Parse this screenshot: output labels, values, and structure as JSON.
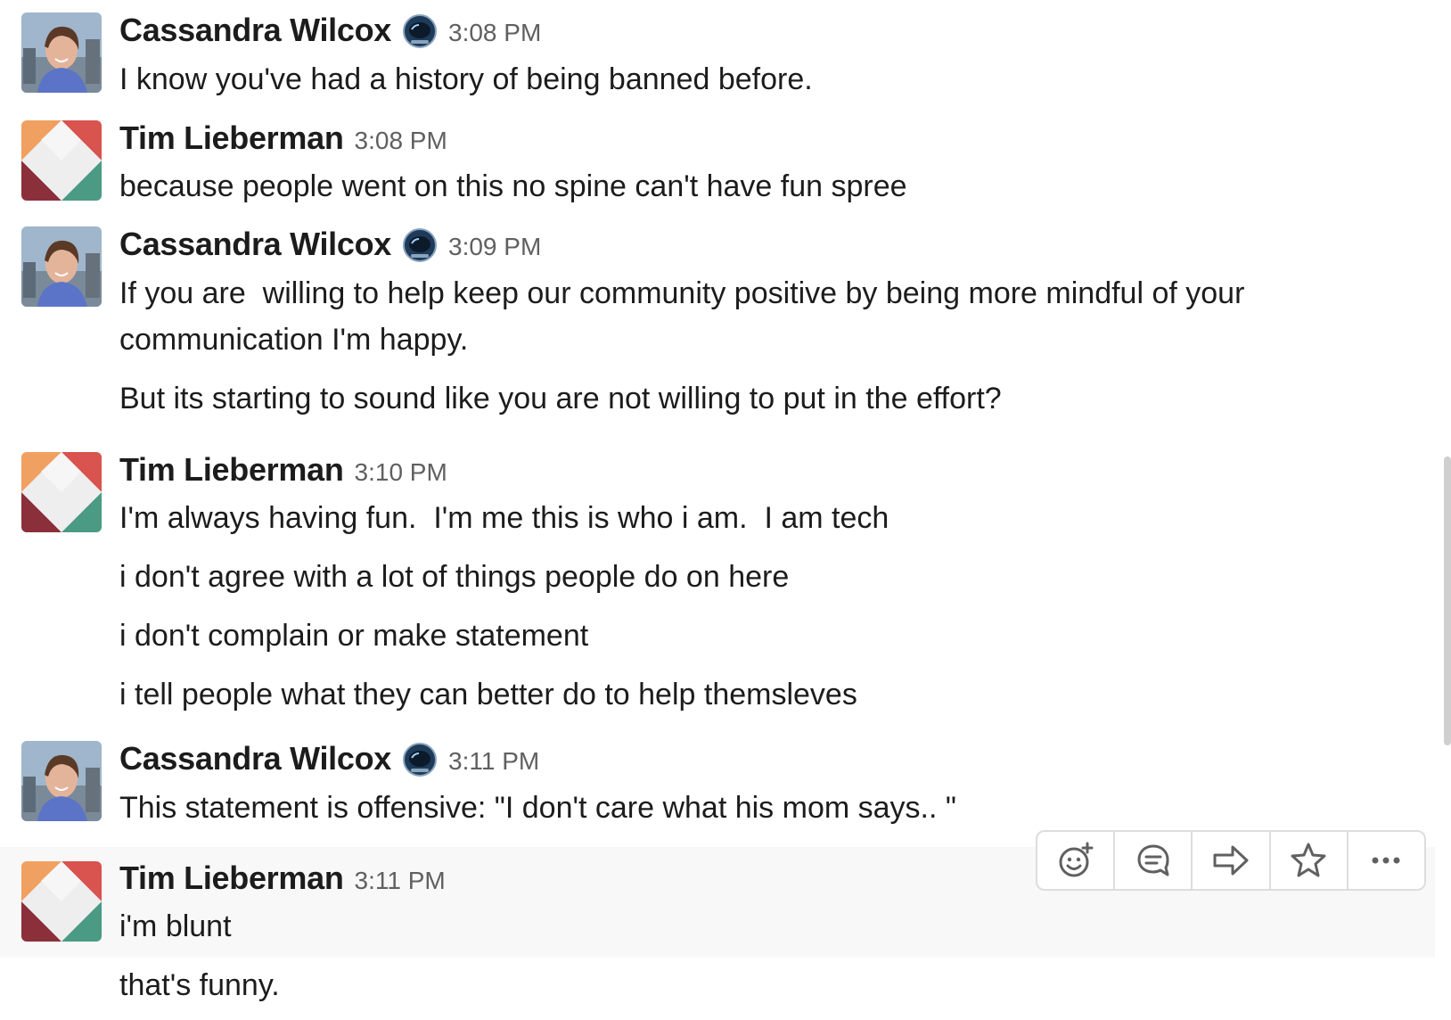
{
  "messages": [
    {
      "sender": "Cassandra Wilcox",
      "time": "3:08 PM",
      "avatar": "cassandra-photo-avatar",
      "badge": "astronaut-helmet-icon",
      "lines": [
        "I know you've had a history of being banned before."
      ]
    },
    {
      "sender": "Tim Lieberman",
      "time": "3:08 PM",
      "avatar": "geometric-quad-avatar",
      "lines": [
        "because people went on this no spine can't have fun spree"
      ]
    },
    {
      "sender": "Cassandra Wilcox",
      "time": "3:09 PM",
      "avatar": "cassandra-photo-avatar",
      "badge": "astronaut-helmet-icon",
      "lines": [
        "If you are  willing to help keep our community positive by being more mindful of your",
        "communication I'm happy.",
        "But its starting to sound like you are not willing to put in the effort?"
      ]
    },
    {
      "sender": "Tim Lieberman",
      "time": "3:10 PM",
      "avatar": "geometric-quad-avatar",
      "lines": [
        "I'm always having fun.  I'm me this is who i am.  I am tech",
        "i don't agree with a lot of things people do on here",
        "i don't complain or make statement",
        "i tell people what they can better do to help themsleves"
      ]
    },
    {
      "sender": "Cassandra Wilcox",
      "time": "3:11 PM",
      "avatar": "cassandra-photo-avatar",
      "badge": "astronaut-helmet-icon",
      "lines": [
        "This statement is offensive: \"I don't care what his mom says.. \""
      ]
    },
    {
      "sender": "Tim Lieberman",
      "time": "3:11 PM",
      "avatar": "geometric-quad-avatar",
      "lines": [
        "i'm blunt",
        "that's funny."
      ]
    }
  ],
  "toolbar": {
    "items": [
      {
        "icon": "add-reaction-icon"
      },
      {
        "icon": "reply-in-thread-icon"
      },
      {
        "icon": "share-message-icon"
      },
      {
        "icon": "star-icon"
      },
      {
        "icon": "more-actions-icon"
      }
    ]
  },
  "colors": {
    "text": "#1d1c1d",
    "timestamp": "#616061",
    "hover_background": "#f8f8f8",
    "toolbar_border": "#dddddd",
    "icon": "#616061"
  }
}
